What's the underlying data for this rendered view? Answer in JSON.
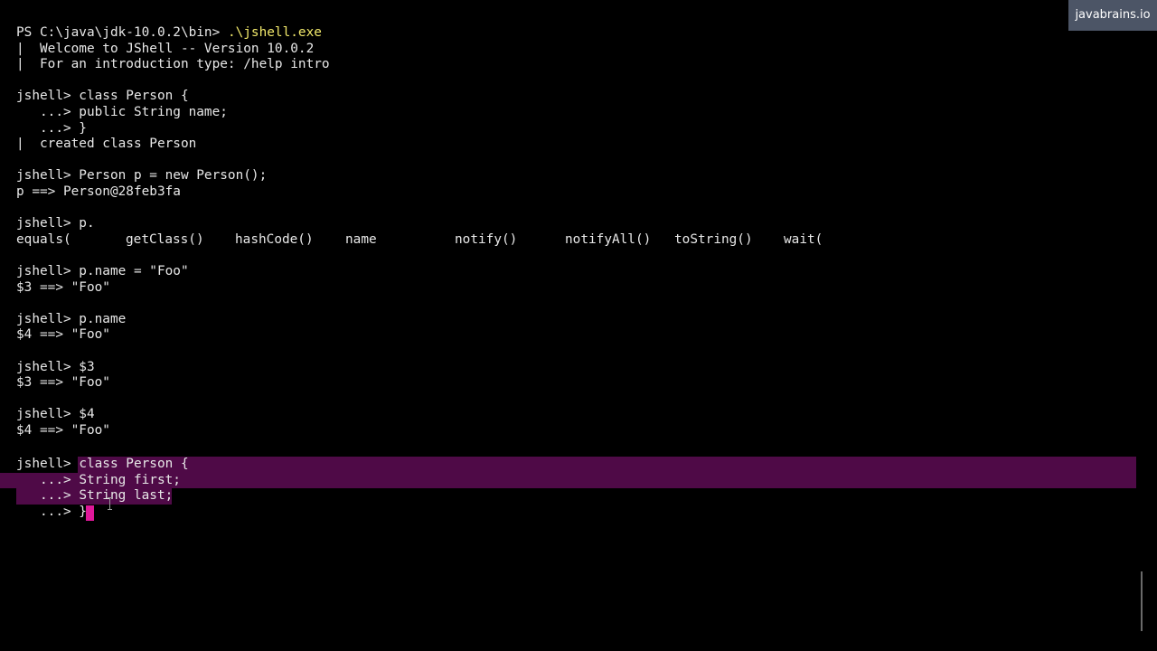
{
  "branding": {
    "label": "javabrains.io"
  },
  "terminal": {
    "prompt_line": {
      "prefix": "PS C:\\java\\jdk-10.0.2\\bin> ",
      "command": ".\\jshell.exe"
    },
    "welcome": "|  Welcome to JShell -- Version 10.0.2",
    "intro": "|  For an introduction type: /help intro",
    "class1": {
      "line1": "jshell> class Person {",
      "line2": "   ...> public String name;",
      "line3": "   ...> }",
      "result": "|  created class Person"
    },
    "new_person": {
      "input": "jshell> Person p = new Person();",
      "output": "p ==> Person@28feb3fa"
    },
    "completion": {
      "input": "jshell> p.",
      "items": [
        "equals(",
        "getClass()",
        "hashCode()",
        "name",
        "notify()",
        "notifyAll()",
        "toString()",
        "wait("
      ]
    },
    "assign": {
      "input": "jshell> p.name = \"Foo\"",
      "output": "$3 ==> \"Foo\""
    },
    "read_name": {
      "input": "jshell> p.name",
      "output": "$4 ==> \"Foo\""
    },
    "var3": {
      "input": "jshell> $3",
      "output": "$3 ==> \"Foo\""
    },
    "var4": {
      "input": "jshell> $4",
      "output": "$4 ==> \"Foo\""
    },
    "class2": {
      "prompt": "jshell> ",
      "line1": "class Person {",
      "line2_prompt": "   ...> ",
      "line2": "String first;",
      "line3_prompt": "   ...> ",
      "line3": "String last;",
      "line4": "   ...> }"
    }
  },
  "colors": {
    "background": "#000000",
    "text": "#e8e8e8",
    "command_highlight": "#f2e96b",
    "selection": "#4f0a47",
    "cursor": "#e0189a",
    "brand_badge": "#4c5566"
  }
}
